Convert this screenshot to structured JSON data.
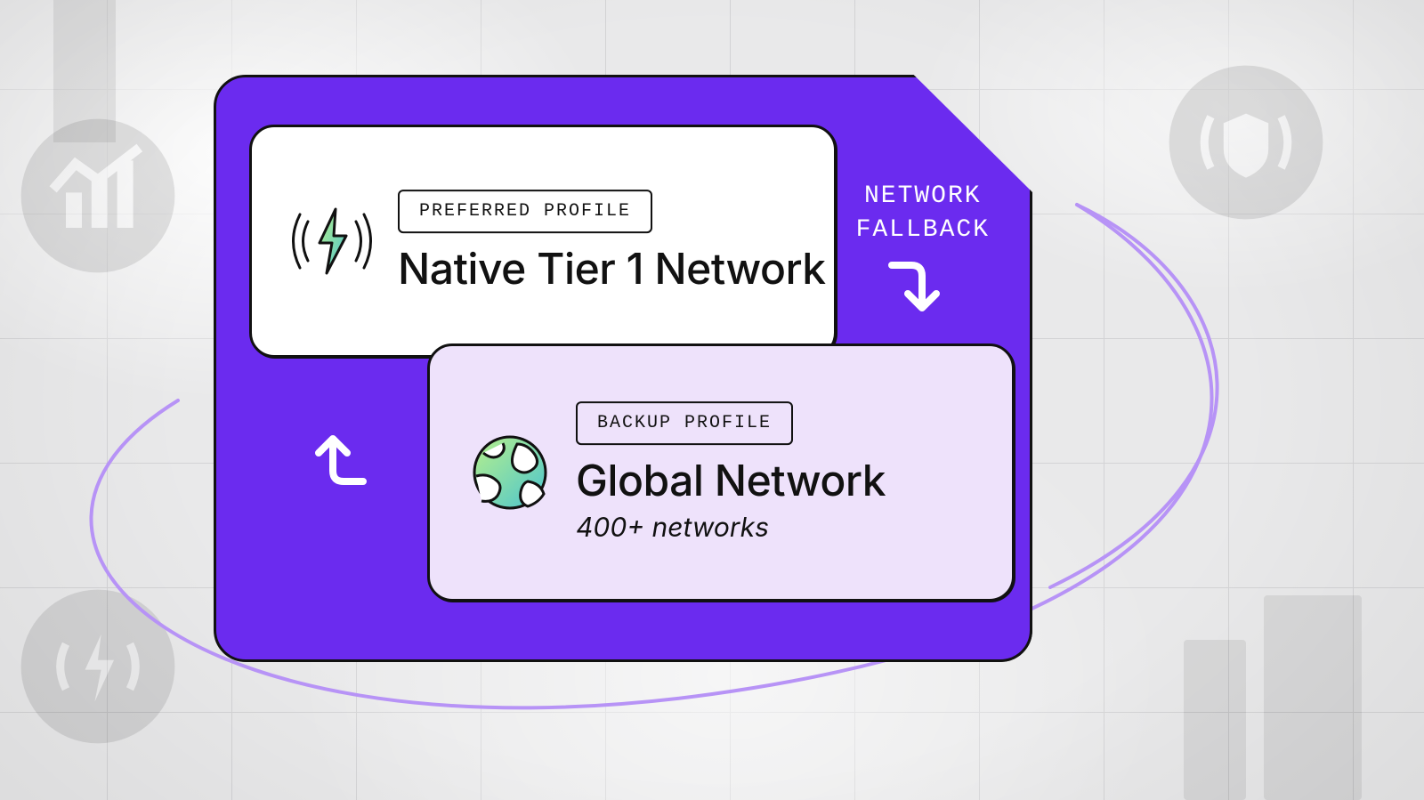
{
  "colors": {
    "purple": "#6B2BEF",
    "lavender": "#EEE2FB",
    "black": "#111111",
    "white": "#FFFFFF"
  },
  "fallback": {
    "line1": "NETWORK",
    "line2": "FALLBACK"
  },
  "preferred": {
    "chip": "PREFERRED PROFILE",
    "title": "Native Tier 1 Network",
    "icon": "signal-bolt-icon"
  },
  "backup": {
    "chip": "BACKUP PROFILE",
    "title": "Global Network",
    "subtitle": "400+ networks",
    "icon": "globe-icon"
  }
}
